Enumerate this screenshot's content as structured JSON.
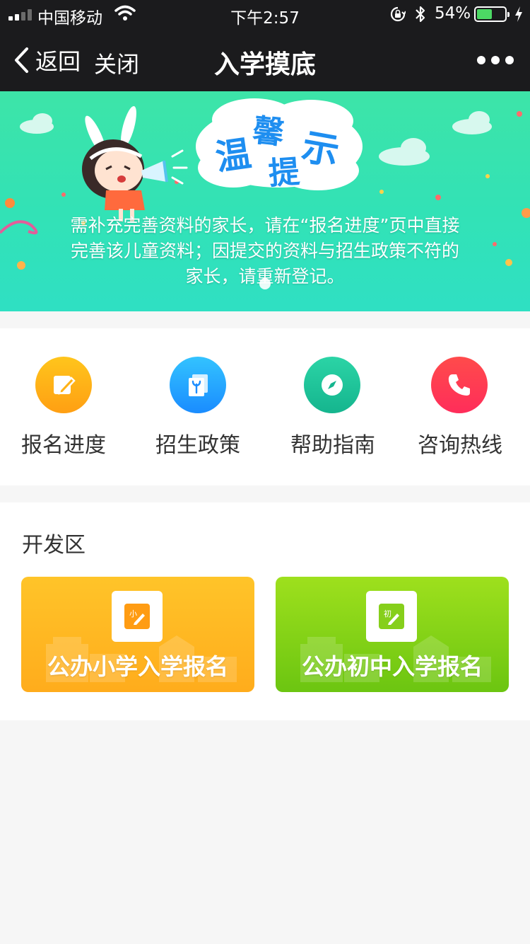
{
  "status_bar": {
    "carrier": "中国移动",
    "time": "下午2:57",
    "battery_percent": "54%",
    "battery_level": 0.54
  },
  "nav": {
    "back_label": "返回",
    "close_label": "关闭",
    "title": "入学摸底"
  },
  "banner": {
    "heading_art": "温馨提示",
    "message": "需补充完善资料的家长，请在“报名进度”页中直接完善该儿童资料；因提交的资料与招生政策不符的家长，请重新登记。"
  },
  "quick_menu": [
    {
      "label": "报名进度",
      "icon": "edit-icon",
      "color": "#ffb318"
    },
    {
      "label": "招生政策",
      "icon": "policy-book-icon",
      "color": "#28a8ff"
    },
    {
      "label": "帮助指南",
      "icon": "compass-icon",
      "color": "#1fc59a"
    },
    {
      "label": "咨询热线",
      "icon": "phone-icon",
      "color": "#ff3a52"
    }
  ],
  "dev_section": {
    "title": "开发区",
    "cards": [
      {
        "label": "公办小学入学报名",
        "icon": "primary-school-icon",
        "color": "#ffb522"
      },
      {
        "label": "公办初中入学报名",
        "icon": "junior-school-icon",
        "color": "#86d216"
      }
    ]
  }
}
